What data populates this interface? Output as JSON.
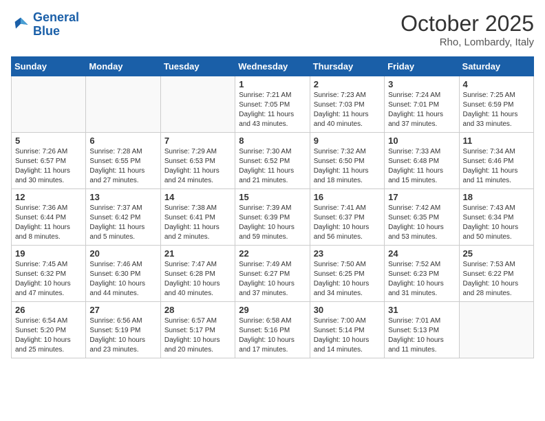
{
  "header": {
    "logo_general": "General",
    "logo_blue": "Blue",
    "month_year": "October 2025",
    "location": "Rho, Lombardy, Italy"
  },
  "weekdays": [
    "Sunday",
    "Monday",
    "Tuesday",
    "Wednesday",
    "Thursday",
    "Friday",
    "Saturday"
  ],
  "weeks": [
    [
      {
        "day": "",
        "info": ""
      },
      {
        "day": "",
        "info": ""
      },
      {
        "day": "",
        "info": ""
      },
      {
        "day": "1",
        "info": "Sunrise: 7:21 AM\nSunset: 7:05 PM\nDaylight: 11 hours\nand 43 minutes."
      },
      {
        "day": "2",
        "info": "Sunrise: 7:23 AM\nSunset: 7:03 PM\nDaylight: 11 hours\nand 40 minutes."
      },
      {
        "day": "3",
        "info": "Sunrise: 7:24 AM\nSunset: 7:01 PM\nDaylight: 11 hours\nand 37 minutes."
      },
      {
        "day": "4",
        "info": "Sunrise: 7:25 AM\nSunset: 6:59 PM\nDaylight: 11 hours\nand 33 minutes."
      }
    ],
    [
      {
        "day": "5",
        "info": "Sunrise: 7:26 AM\nSunset: 6:57 PM\nDaylight: 11 hours\nand 30 minutes."
      },
      {
        "day": "6",
        "info": "Sunrise: 7:28 AM\nSunset: 6:55 PM\nDaylight: 11 hours\nand 27 minutes."
      },
      {
        "day": "7",
        "info": "Sunrise: 7:29 AM\nSunset: 6:53 PM\nDaylight: 11 hours\nand 24 minutes."
      },
      {
        "day": "8",
        "info": "Sunrise: 7:30 AM\nSunset: 6:52 PM\nDaylight: 11 hours\nand 21 minutes."
      },
      {
        "day": "9",
        "info": "Sunrise: 7:32 AM\nSunset: 6:50 PM\nDaylight: 11 hours\nand 18 minutes."
      },
      {
        "day": "10",
        "info": "Sunrise: 7:33 AM\nSunset: 6:48 PM\nDaylight: 11 hours\nand 15 minutes."
      },
      {
        "day": "11",
        "info": "Sunrise: 7:34 AM\nSunset: 6:46 PM\nDaylight: 11 hours\nand 11 minutes."
      }
    ],
    [
      {
        "day": "12",
        "info": "Sunrise: 7:36 AM\nSunset: 6:44 PM\nDaylight: 11 hours\nand 8 minutes."
      },
      {
        "day": "13",
        "info": "Sunrise: 7:37 AM\nSunset: 6:42 PM\nDaylight: 11 hours\nand 5 minutes."
      },
      {
        "day": "14",
        "info": "Sunrise: 7:38 AM\nSunset: 6:41 PM\nDaylight: 11 hours\nand 2 minutes."
      },
      {
        "day": "15",
        "info": "Sunrise: 7:39 AM\nSunset: 6:39 PM\nDaylight: 10 hours\nand 59 minutes."
      },
      {
        "day": "16",
        "info": "Sunrise: 7:41 AM\nSunset: 6:37 PM\nDaylight: 10 hours\nand 56 minutes."
      },
      {
        "day": "17",
        "info": "Sunrise: 7:42 AM\nSunset: 6:35 PM\nDaylight: 10 hours\nand 53 minutes."
      },
      {
        "day": "18",
        "info": "Sunrise: 7:43 AM\nSunset: 6:34 PM\nDaylight: 10 hours\nand 50 minutes."
      }
    ],
    [
      {
        "day": "19",
        "info": "Sunrise: 7:45 AM\nSunset: 6:32 PM\nDaylight: 10 hours\nand 47 minutes."
      },
      {
        "day": "20",
        "info": "Sunrise: 7:46 AM\nSunset: 6:30 PM\nDaylight: 10 hours\nand 44 minutes."
      },
      {
        "day": "21",
        "info": "Sunrise: 7:47 AM\nSunset: 6:28 PM\nDaylight: 10 hours\nand 40 minutes."
      },
      {
        "day": "22",
        "info": "Sunrise: 7:49 AM\nSunset: 6:27 PM\nDaylight: 10 hours\nand 37 minutes."
      },
      {
        "day": "23",
        "info": "Sunrise: 7:50 AM\nSunset: 6:25 PM\nDaylight: 10 hours\nand 34 minutes."
      },
      {
        "day": "24",
        "info": "Sunrise: 7:52 AM\nSunset: 6:23 PM\nDaylight: 10 hours\nand 31 minutes."
      },
      {
        "day": "25",
        "info": "Sunrise: 7:53 AM\nSunset: 6:22 PM\nDaylight: 10 hours\nand 28 minutes."
      }
    ],
    [
      {
        "day": "26",
        "info": "Sunrise: 6:54 AM\nSunset: 5:20 PM\nDaylight: 10 hours\nand 25 minutes."
      },
      {
        "day": "27",
        "info": "Sunrise: 6:56 AM\nSunset: 5:19 PM\nDaylight: 10 hours\nand 23 minutes."
      },
      {
        "day": "28",
        "info": "Sunrise: 6:57 AM\nSunset: 5:17 PM\nDaylight: 10 hours\nand 20 minutes."
      },
      {
        "day": "29",
        "info": "Sunrise: 6:58 AM\nSunset: 5:16 PM\nDaylight: 10 hours\nand 17 minutes."
      },
      {
        "day": "30",
        "info": "Sunrise: 7:00 AM\nSunset: 5:14 PM\nDaylight: 10 hours\nand 14 minutes."
      },
      {
        "day": "31",
        "info": "Sunrise: 7:01 AM\nSunset: 5:13 PM\nDaylight: 10 hours\nand 11 minutes."
      },
      {
        "day": "",
        "info": ""
      }
    ]
  ]
}
